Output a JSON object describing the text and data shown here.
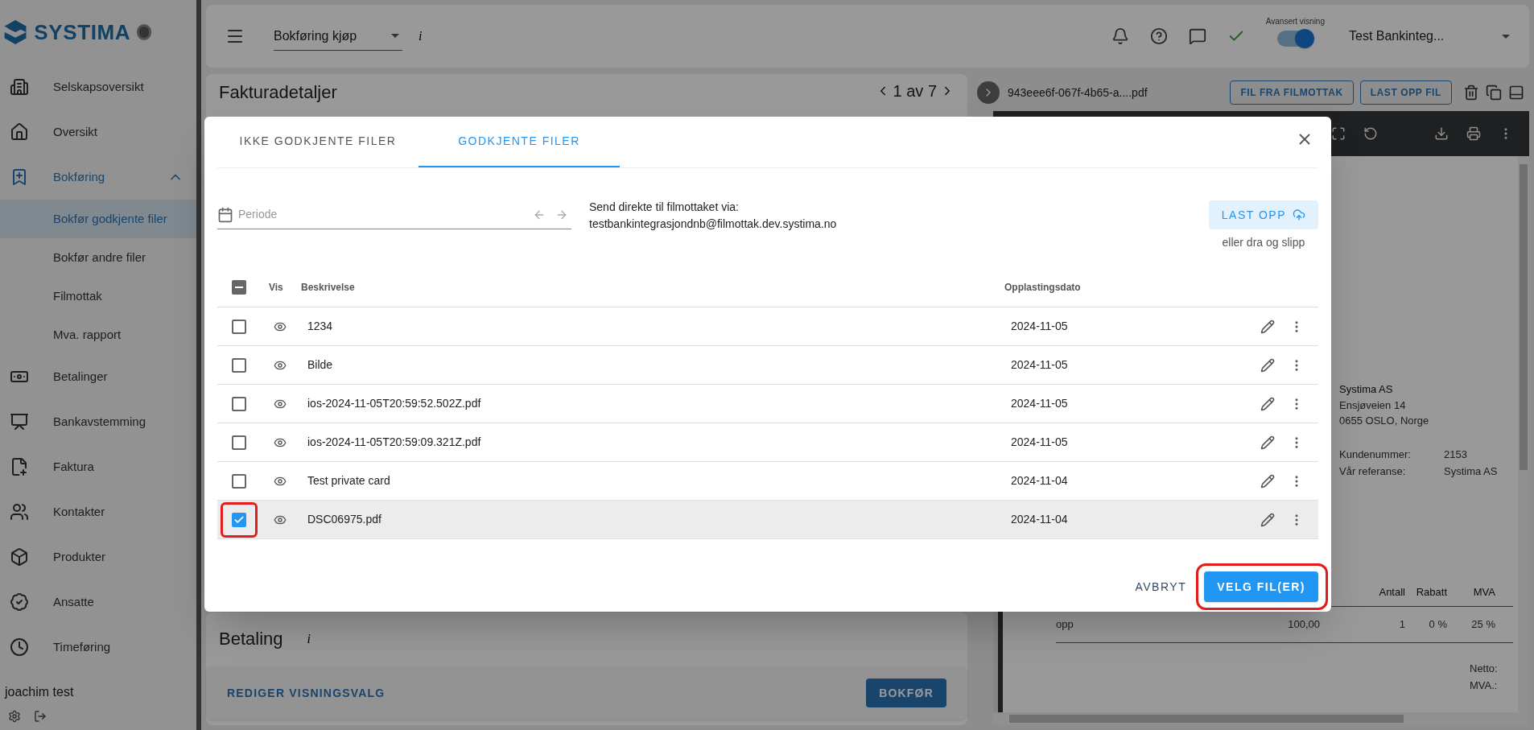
{
  "sidebar": {
    "logo": "SYSTIMA",
    "items": [
      {
        "label": "Selskapsoversikt",
        "selected": false
      },
      {
        "label": "Oversikt",
        "selected": false
      },
      {
        "label": "Bokføring",
        "selected": false,
        "expanded": true,
        "children": [
          {
            "label": "Bokfør godkjente filer",
            "selected": true
          },
          {
            "label": "Bokfør andre filer",
            "selected": false
          },
          {
            "label": "Filmottak",
            "selected": false
          },
          {
            "label": "Mva. rapport",
            "selected": false
          }
        ]
      },
      {
        "label": "Betalinger",
        "selected": false
      },
      {
        "label": "Bankavstemming",
        "selected": false
      },
      {
        "label": "Faktura",
        "selected": false
      },
      {
        "label": "Kontakter",
        "selected": false
      },
      {
        "label": "Produkter",
        "selected": false
      },
      {
        "label": "Ansatte",
        "selected": false
      },
      {
        "label": "Timeføring",
        "selected": false
      }
    ],
    "user": "joachim test"
  },
  "header": {
    "page_select": "Bokføring kjøp",
    "info": "i",
    "advanced_view": {
      "label": "Avansert visning",
      "on": true
    },
    "company": "Test Bankinteg..."
  },
  "invoice_card": {
    "title": "Fakturadetaljer",
    "pager": "1 av 7"
  },
  "payment_card": {
    "title": "Betaling",
    "info": "i"
  },
  "action_bar": {
    "secondary": "REDIGER VISNINGSVALG",
    "primary": "BOKFØR"
  },
  "viewer": {
    "filename": "943eee6f-067f-4b65-a....pdf",
    "buttons": [
      "FIL FRA FILMOTTAK",
      "LAST OPP FIL"
    ],
    "document": {
      "sender": "Systima AS",
      "address": [
        "Ensjøveien 14",
        "0655 OSLO, Norge"
      ],
      "fields": [
        {
          "label": "Kundenummer:",
          "value": "2153"
        },
        {
          "label": "Vår referanse:",
          "value": "Systima AS"
        }
      ],
      "columns": [
        "",
        "",
        "Antall",
        "Rabatt",
        "MVA"
      ],
      "rows": [
        [
          "opp",
          "100,00",
          "1",
          "0 %",
          "25 %"
        ]
      ],
      "totals": [
        "Netto:",
        "MVA.:"
      ]
    }
  },
  "dialog": {
    "tabs": [
      {
        "label": "IKKE GODKJENTE FILER",
        "selected": false
      },
      {
        "label": "GODKJENTE FILER",
        "selected": true
      }
    ],
    "period": {
      "placeholder": "Periode"
    },
    "send_info": [
      "Send direkte til filmottaket via:",
      "testbankintegrasjondnb@filmottak.dev.systima.no"
    ],
    "upload": {
      "label": "LAST OPP",
      "hint": "eller dra og slipp"
    },
    "select_all": {
      "indeterminate": true
    },
    "columns": [
      "Vis",
      "Beskrivelse",
      "Opplastingsdato"
    ],
    "rows": [
      {
        "description": "1234",
        "date": "2024-11-05",
        "checked": false,
        "selected": false,
        "annotated": false
      },
      {
        "description": "Bilde",
        "date": "2024-11-05",
        "checked": false,
        "selected": false,
        "annotated": false
      },
      {
        "description": "ios-2024-11-05T20:59:52.502Z.pdf",
        "date": "2024-11-05",
        "checked": false,
        "selected": false,
        "annotated": false
      },
      {
        "description": "ios-2024-11-05T20:59:09.321Z.pdf",
        "date": "2024-11-05",
        "checked": false,
        "selected": false,
        "annotated": false
      },
      {
        "description": "Test private card",
        "date": "2024-11-04",
        "checked": false,
        "selected": false,
        "annotated": false
      },
      {
        "description": "DSC06975.pdf",
        "date": "2024-11-04",
        "checked": true,
        "selected": true,
        "annotated": true
      }
    ],
    "cancel": "AVBRYT",
    "confirm": {
      "label": "VELG FIL(ER)",
      "annotated": true
    }
  }
}
